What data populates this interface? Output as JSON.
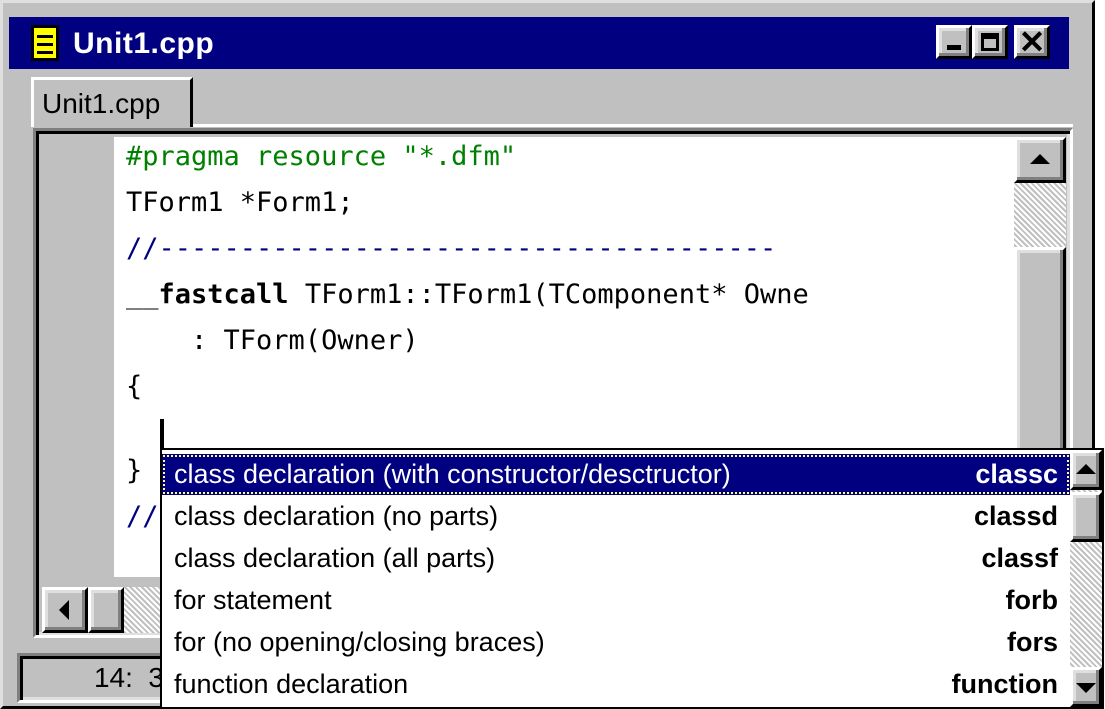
{
  "window": {
    "title": "Unit1.cpp",
    "title_icon": "document-icon",
    "buttons": {
      "minimize": "minimize-icon",
      "maximize": "maximize-icon",
      "close": "close-icon",
      "close_glyph": "✕"
    },
    "colors": {
      "titlebar": "#000080",
      "face": "#c0c0c0",
      "selection": "#000080"
    }
  },
  "tabs": [
    {
      "label": "Unit1.cpp",
      "active": true
    }
  ],
  "editor": {
    "lines": [
      {
        "text": "#pragma resource \"*.dfm\""
      },
      {
        "text": "TForm1 *Form1;"
      },
      {
        "text": "//--------------------------------------"
      },
      {
        "prefix": "__",
        "keyword": "fastcall",
        "rest": " TForm1::TForm1(TComponent* Owne"
      },
      {
        "text": "    : TForm(Owner)"
      },
      {
        "text": "{"
      },
      {
        "text": ""
      },
      {
        "text": "}"
      },
      {
        "text": "//"
      }
    ]
  },
  "status": {
    "position": "14:  3"
  },
  "popup": {
    "items": [
      {
        "label": "class declaration (with constructor/desctructor)",
        "shortcut": "classc",
        "selected": true
      },
      {
        "label": "class declaration (no parts)",
        "shortcut": "classd",
        "selected": false
      },
      {
        "label": "class declaration (all parts)",
        "shortcut": "classf",
        "selected": false
      },
      {
        "label": "for statement",
        "shortcut": "forb",
        "selected": false
      },
      {
        "label": "for (no opening/closing braces)",
        "shortcut": "fors",
        "selected": false
      },
      {
        "label": "function declaration",
        "shortcut": "function",
        "selected": false
      }
    ]
  }
}
